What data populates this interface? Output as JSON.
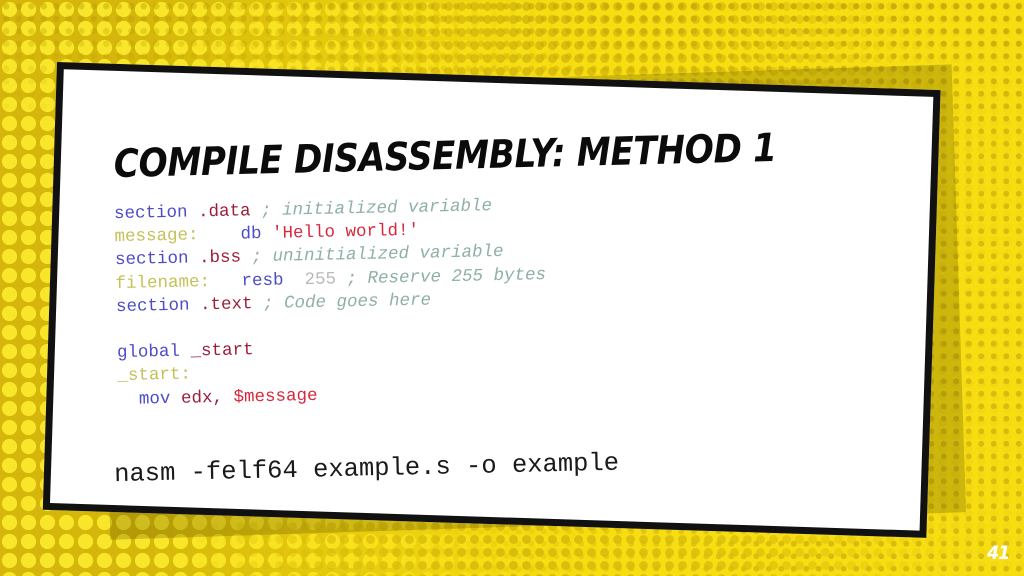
{
  "slide": {
    "title": "COMPILE DISASSEMBLY: METHOD 1",
    "page_number": "41",
    "background_color": "#F7DE12",
    "background_dot_color": "#D4B70A",
    "card_background": "#FFFFFF",
    "card_border_color": "#111111"
  },
  "code": {
    "language": "nasm",
    "lines": [
      {
        "id": "line-1",
        "tokens": [
          {
            "text": "section",
            "type": "keyword",
            "color": "#4C4CC8"
          },
          {
            "text": " ",
            "type": "plain"
          },
          {
            "text": ".data",
            "type": "section",
            "color": "#9B1F3A"
          },
          {
            "text": " ",
            "type": "plain"
          },
          {
            "text": "; initialized variable",
            "type": "comment",
            "color": "#8FAFA8"
          }
        ]
      },
      {
        "id": "line-2",
        "tokens": [
          {
            "text": "message:",
            "type": "label",
            "color": "#C5C15A"
          },
          {
            "text": "    ",
            "type": "plain"
          },
          {
            "text": "db",
            "type": "keyword",
            "color": "#4C4CC8"
          },
          {
            "text": " ",
            "type": "plain"
          },
          {
            "text": "'Hello world!'",
            "type": "string",
            "color": "#D9283C"
          }
        ]
      },
      {
        "id": "line-3",
        "tokens": [
          {
            "text": "section",
            "type": "keyword",
            "color": "#4C4CC8"
          },
          {
            "text": " ",
            "type": "plain"
          },
          {
            "text": ".bss",
            "type": "section",
            "color": "#9B1F3A"
          },
          {
            "text": " ",
            "type": "plain"
          },
          {
            "text": "; uninitialized variable",
            "type": "comment",
            "color": "#8FAFA8"
          }
        ]
      },
      {
        "id": "line-4",
        "tokens": [
          {
            "text": "filename:",
            "type": "label",
            "color": "#C5C15A"
          },
          {
            "text": "   ",
            "type": "plain"
          },
          {
            "text": "resb",
            "type": "keyword",
            "color": "#4C4CC8"
          },
          {
            "text": "  ",
            "type": "plain"
          },
          {
            "text": "255",
            "type": "number",
            "color": "#B9B9B9"
          },
          {
            "text": " ",
            "type": "plain"
          },
          {
            "text": "; Reserve 255 bytes",
            "type": "comment",
            "color": "#8FAFA8"
          }
        ]
      },
      {
        "id": "line-5",
        "tokens": [
          {
            "text": "section",
            "type": "keyword",
            "color": "#4C4CC8"
          },
          {
            "text": " ",
            "type": "plain"
          },
          {
            "text": ".text",
            "type": "section",
            "color": "#9B1F3A"
          },
          {
            "text": " ",
            "type": "plain"
          },
          {
            "text": "; Code goes here",
            "type": "comment",
            "color": "#8FAFA8"
          }
        ]
      },
      {
        "id": "line-6",
        "tokens": []
      },
      {
        "id": "line-7",
        "tokens": [
          {
            "text": "global",
            "type": "keyword",
            "color": "#4C4CC8"
          },
          {
            "text": " ",
            "type": "plain"
          },
          {
            "text": "_start",
            "type": "section",
            "color": "#9B1F3A"
          }
        ]
      },
      {
        "id": "line-8",
        "tokens": [
          {
            "text": "_start:",
            "type": "label",
            "color": "#C5C15A"
          }
        ]
      },
      {
        "id": "line-9",
        "tokens": [
          {
            "text": "  ",
            "type": "plain"
          },
          {
            "text": "mov",
            "type": "keyword",
            "color": "#4C4CC8"
          },
          {
            "text": " ",
            "type": "plain"
          },
          {
            "text": "edx,",
            "type": "register",
            "color": "#9B1F3A"
          },
          {
            "text": " ",
            "type": "plain"
          },
          {
            "text": "$message",
            "type": "var",
            "color": "#D9283C"
          }
        ]
      }
    ]
  },
  "command": {
    "text": "nasm -felf64 example.s -o example"
  }
}
